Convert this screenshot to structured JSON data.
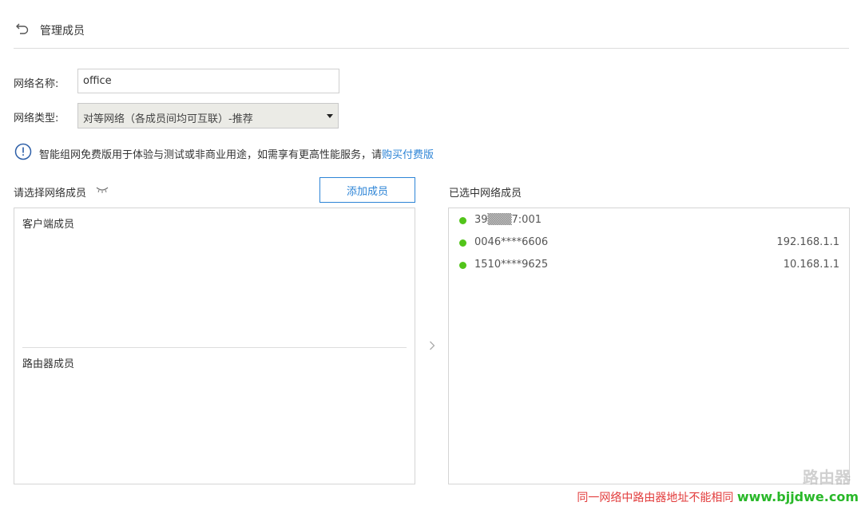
{
  "header": {
    "title": "管理成员",
    "back_icon": "undo-arrow-icon"
  },
  "form": {
    "name_label": "网络名称:",
    "name_value": "office",
    "type_label": "网络类型:",
    "type_value": "对等网络（各成员间均可互联）-推荐"
  },
  "notice": {
    "text": "智能组网免费版用于体验与测试或非商业用途，如需享有更高性能服务，请",
    "link": "购买付费版"
  },
  "left_panel": {
    "label": "请选择网络成员",
    "add_button": "添加成员",
    "client_group": "客户端成员",
    "router_group": "路由器成员"
  },
  "right_panel": {
    "label": "已选中网络成员",
    "members": [
      {
        "id": "39▒▒▒7:001",
        "ip": ""
      },
      {
        "id": "0046****6606",
        "ip": "192.168.1.1"
      },
      {
        "id": "1510****9625",
        "ip": "10.168.1.1"
      }
    ]
  },
  "watermark": {
    "red_text": "同一网络中路由器地址不能相同",
    "green_text": "www.bjjdwe.com",
    "logo": "路由器"
  },
  "colors": {
    "accent": "#2d84d6",
    "online": "#52c41a",
    "border": "#d5d5d5"
  }
}
